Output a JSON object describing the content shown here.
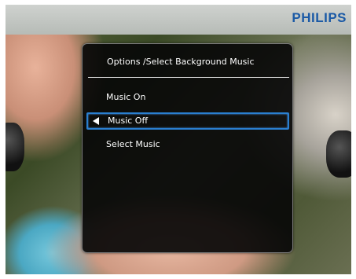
{
  "brand": {
    "logo_text": "PHILIPS",
    "color": "#1b5aa6"
  },
  "dialog": {
    "title": "Options /Select Background Music",
    "items": [
      {
        "label": "Music On",
        "selected": false
      },
      {
        "label": "Music Off",
        "selected": true,
        "icon": "left-arrow-icon"
      },
      {
        "label": "Select Music",
        "selected": false
      }
    ],
    "accent_color": "#2a7fd0"
  }
}
